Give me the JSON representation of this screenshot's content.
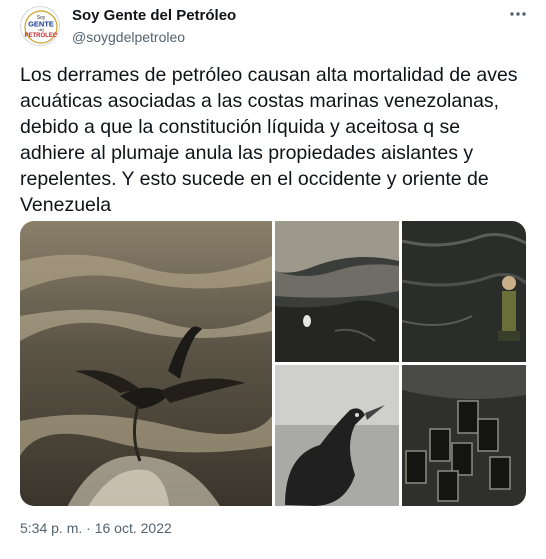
{
  "author": {
    "name": "Soy Gente del Petróleo",
    "handle": "@soygdelpetroleo",
    "avatar_text_top": "Soy",
    "avatar_text_mid": "GENTE",
    "avatar_text_sub": "del",
    "avatar_text_bottom": "PETRÓLEO"
  },
  "tweet": {
    "text": "Los derrames de petróleo causan alta mortalidad de aves acuáticas asociadas a las costas marinas venezolanas, debido a que la constitución líquida y aceitosa q se adhiere al plumaje anula las propiedades aislantes y repelentes. Y esto sucede en el occidente y oriente de Venezuela",
    "time": "5:34 p. m.",
    "separator": "·",
    "date": "16 oct. 2022"
  },
  "icons": {
    "more": "more-options-icon"
  }
}
